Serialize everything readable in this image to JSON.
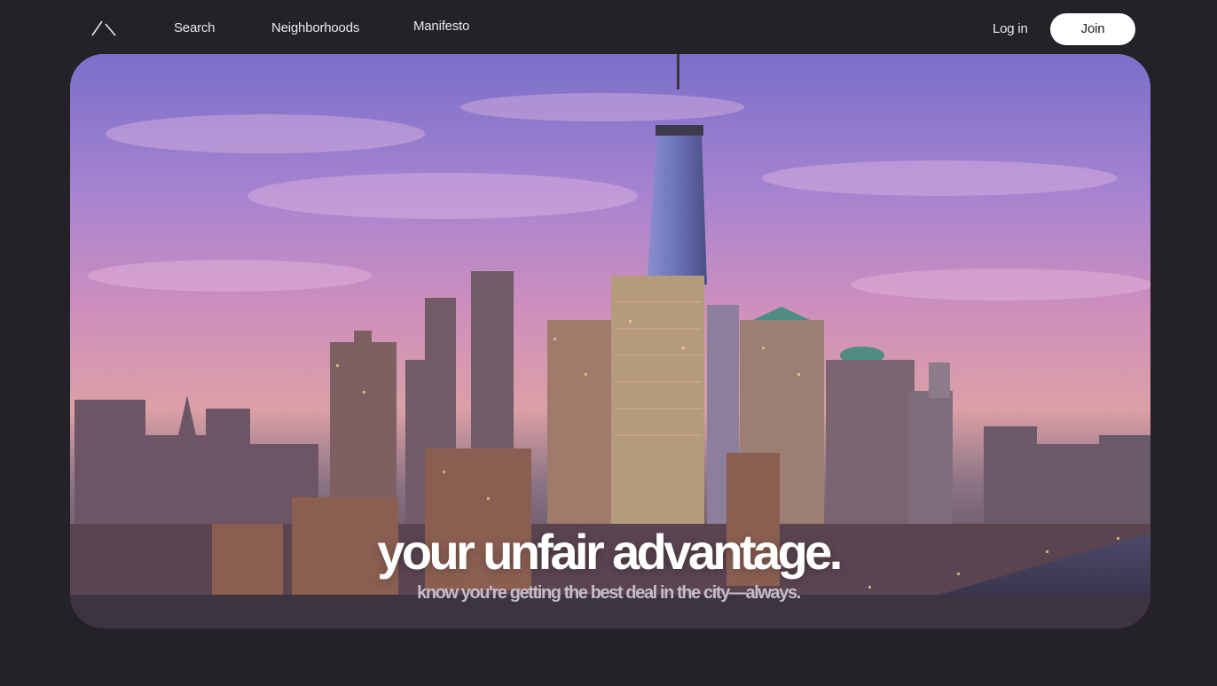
{
  "nav": {
    "logo_icon": "peak-logo-icon",
    "links": [
      "Search",
      "Neighborhoods",
      "Manifesto"
    ],
    "login_label": "Log in",
    "join_label": "Join"
  },
  "hero": {
    "image": "city-skyline-at-sunset",
    "headline": "your unfair advantage.",
    "subheadline": "know you're getting the best deal in the city—always."
  },
  "colors": {
    "page_background": "#242128",
    "join_button": "#ffffff",
    "nav_text": "#e9e6ee"
  }
}
